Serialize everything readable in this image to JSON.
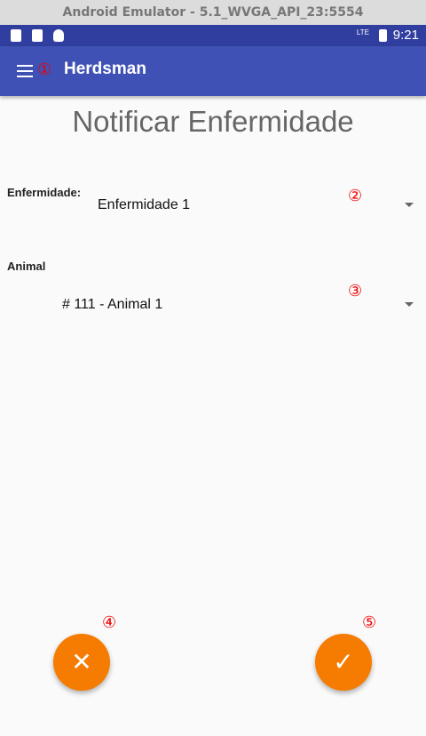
{
  "window_title": "Android Emulator - 5.1_WVGA_API_23:5554",
  "status_bar": {
    "time": "9:21",
    "network": "LTE"
  },
  "app_bar": {
    "title": "Herdsman",
    "marker": "①"
  },
  "page_title": "Notificar Enfermidade",
  "form": {
    "disease_label": "Enfermidade:",
    "disease_value": "Enfermidade 1",
    "disease_marker": "②",
    "animal_label": "Animal",
    "animal_value": "# 111 - Animal 1",
    "animal_marker": "③"
  },
  "actions": {
    "cancel_marker": "④",
    "confirm_marker": "⑤",
    "cancel_icon": "✕",
    "confirm_icon": "✓"
  },
  "colors": {
    "primary": "#3f51b5",
    "primary_dark": "#303f9f",
    "accent": "#f57c00"
  }
}
